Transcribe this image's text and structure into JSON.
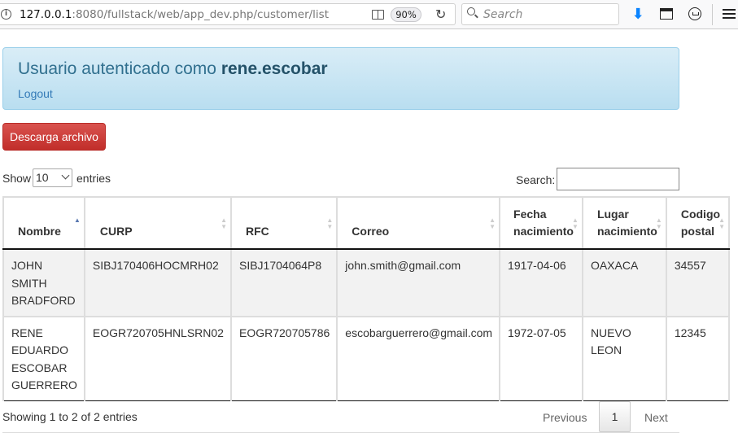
{
  "browser": {
    "url_host": "127.0.0.1",
    "url_rest": ":8080/fullstack/web/app_dev.php/customer/list",
    "zoom": "90%",
    "search_placeholder": "Search"
  },
  "alert": {
    "prefix": "Usuario autenticado como ",
    "username": "rene.escobar",
    "logout": "Logout"
  },
  "download_button": "Descarga archivo",
  "length_control": {
    "show": "Show",
    "value": "10",
    "entries": "entries"
  },
  "search": {
    "label": "Search:",
    "value": ""
  },
  "table": {
    "headers": [
      {
        "text": "Nombre",
        "sort": "asc"
      },
      {
        "text": "CURP",
        "sort": "both"
      },
      {
        "text": "RFC",
        "sort": "both"
      },
      {
        "text": "Correo",
        "sort": "both"
      },
      {
        "text": "Fecha nacimiento",
        "sort": "both"
      },
      {
        "text": "Lugar nacimiento",
        "sort": "both"
      },
      {
        "text": "Codigo postal",
        "sort": "both"
      }
    ],
    "rows": [
      [
        "JOHN SMITH BRADFORD",
        "SIBJ170406HOCMRH02",
        "SIBJ1704064P8",
        "john.smith@gmail.com",
        "1917-04-06",
        "OAXACA",
        "34557"
      ],
      [
        "RENE EDUARDO ESCOBAR GUERRERO",
        "EOGR720705HNLSRN02",
        "EOGR720705786",
        "escobarguerrero@gmail.com",
        "1972-07-05",
        "NUEVO LEON",
        "12345"
      ]
    ]
  },
  "footer": {
    "info": "Showing 1 to 2 of 2 entries",
    "previous": "Previous",
    "page": "1",
    "next": "Next"
  }
}
